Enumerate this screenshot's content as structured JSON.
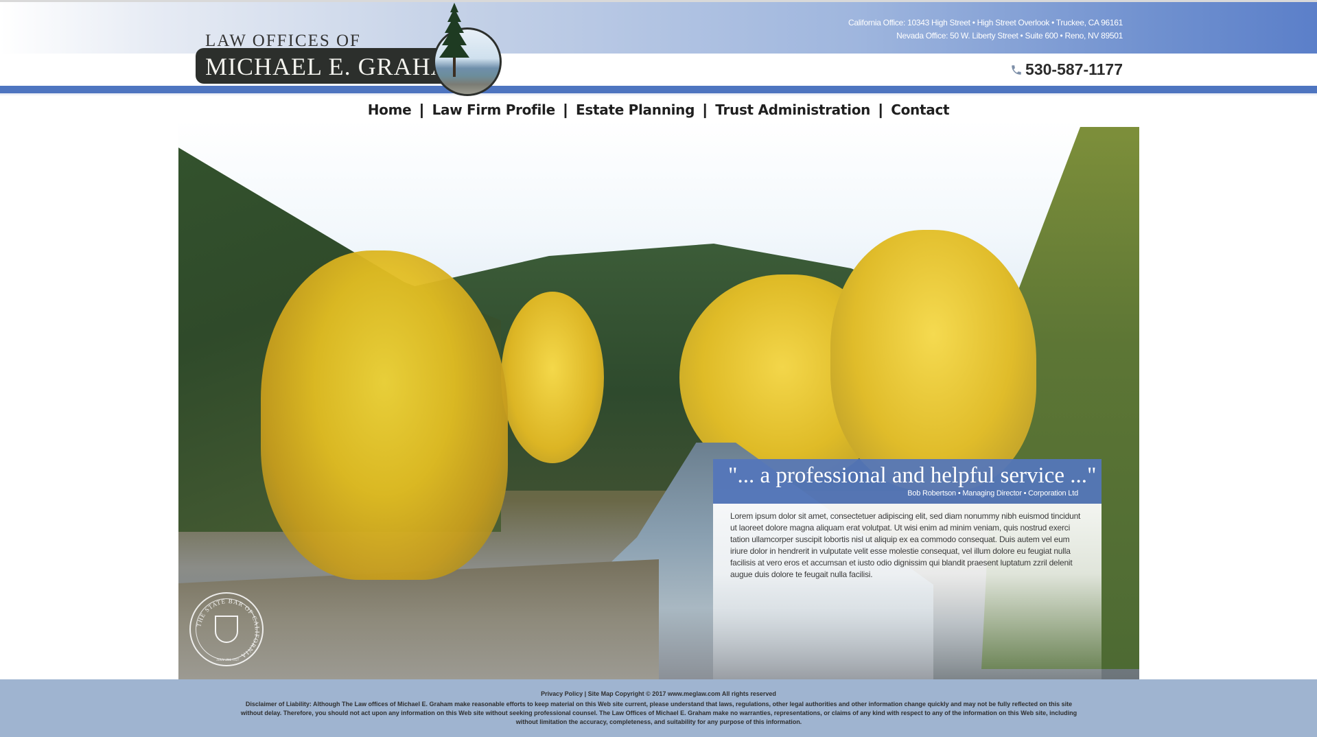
{
  "header": {
    "logo": {
      "line1": "LAW OFFICES OF",
      "line2": "MICHAEL E. GRAHAM"
    },
    "addresses": [
      "California Office: 10343 High Street • High Street Overlook • Truckee, CA 96161",
      "Nevada Office: 50 W. Liberty Street • Suite 600 • Reno, NV 89501"
    ],
    "phone": "530-587-1177",
    "phone_icon": "phone-icon",
    "colors": {
      "accent_blue": "#4e75c0",
      "footer_bg": "#9fb4d0"
    }
  },
  "nav": {
    "items": [
      {
        "label": "Home"
      },
      {
        "label": "Law Firm Profile"
      },
      {
        "label": "Estate Planning"
      },
      {
        "label": "Trust Administration"
      },
      {
        "label": "Contact"
      }
    ],
    "separator": "|"
  },
  "hero": {
    "quote": {
      "title": "\"... a professional and helpful service ...\"",
      "author": "Bob Robertson • Managing Director • Corporation Ltd",
      "body": "Lorem ipsum dolor sit amet, consectetuer adipiscing elit, sed diam nonummy nibh euismod tincidunt ut laoreet dolore magna aliquam erat volutpat. Ut wisi enim ad minim veniam, quis nostrud exerci tation ullamcorper suscipit lobortis nisl ut aliquip ex ea commodo consequat. Duis autem vel eum iriure dolor in hendrerit in vulputate velit esse molestie consequat, vel illum dolore eu feugiat nulla facilisis at vero eros et accumsan et iusto odio dignissim qui blandit praesent luptatum zzril delenit augue duis dolore te feugait nulla facilisi."
    },
    "seal": {
      "text": "THE STATE BAR OF CALIFORNIA",
      "date": "JULY 29th 1927"
    }
  },
  "footer": {
    "links": "Privacy Policy | Site Map Copyright © 2017 www.meglaw.com All rights reserved",
    "disclaimer": "Disclaimer of Liability: Although The Law offices of Michael E. Graham make reasonable efforts to keep material on this Web site current, please understand that laws, regulations, other legal authorities and other information change quickly and may not be fully reflected on this site without delay. Therefore, you should not act upon any information on this Web site without seeking professional counsel. The Law Offices of Michael E. Graham make no warranties, representations, or claims of any kind with respect to any of the information on this Web site, including without limitation the accuracy, completeness, and suitability for any purpose of this information."
  }
}
